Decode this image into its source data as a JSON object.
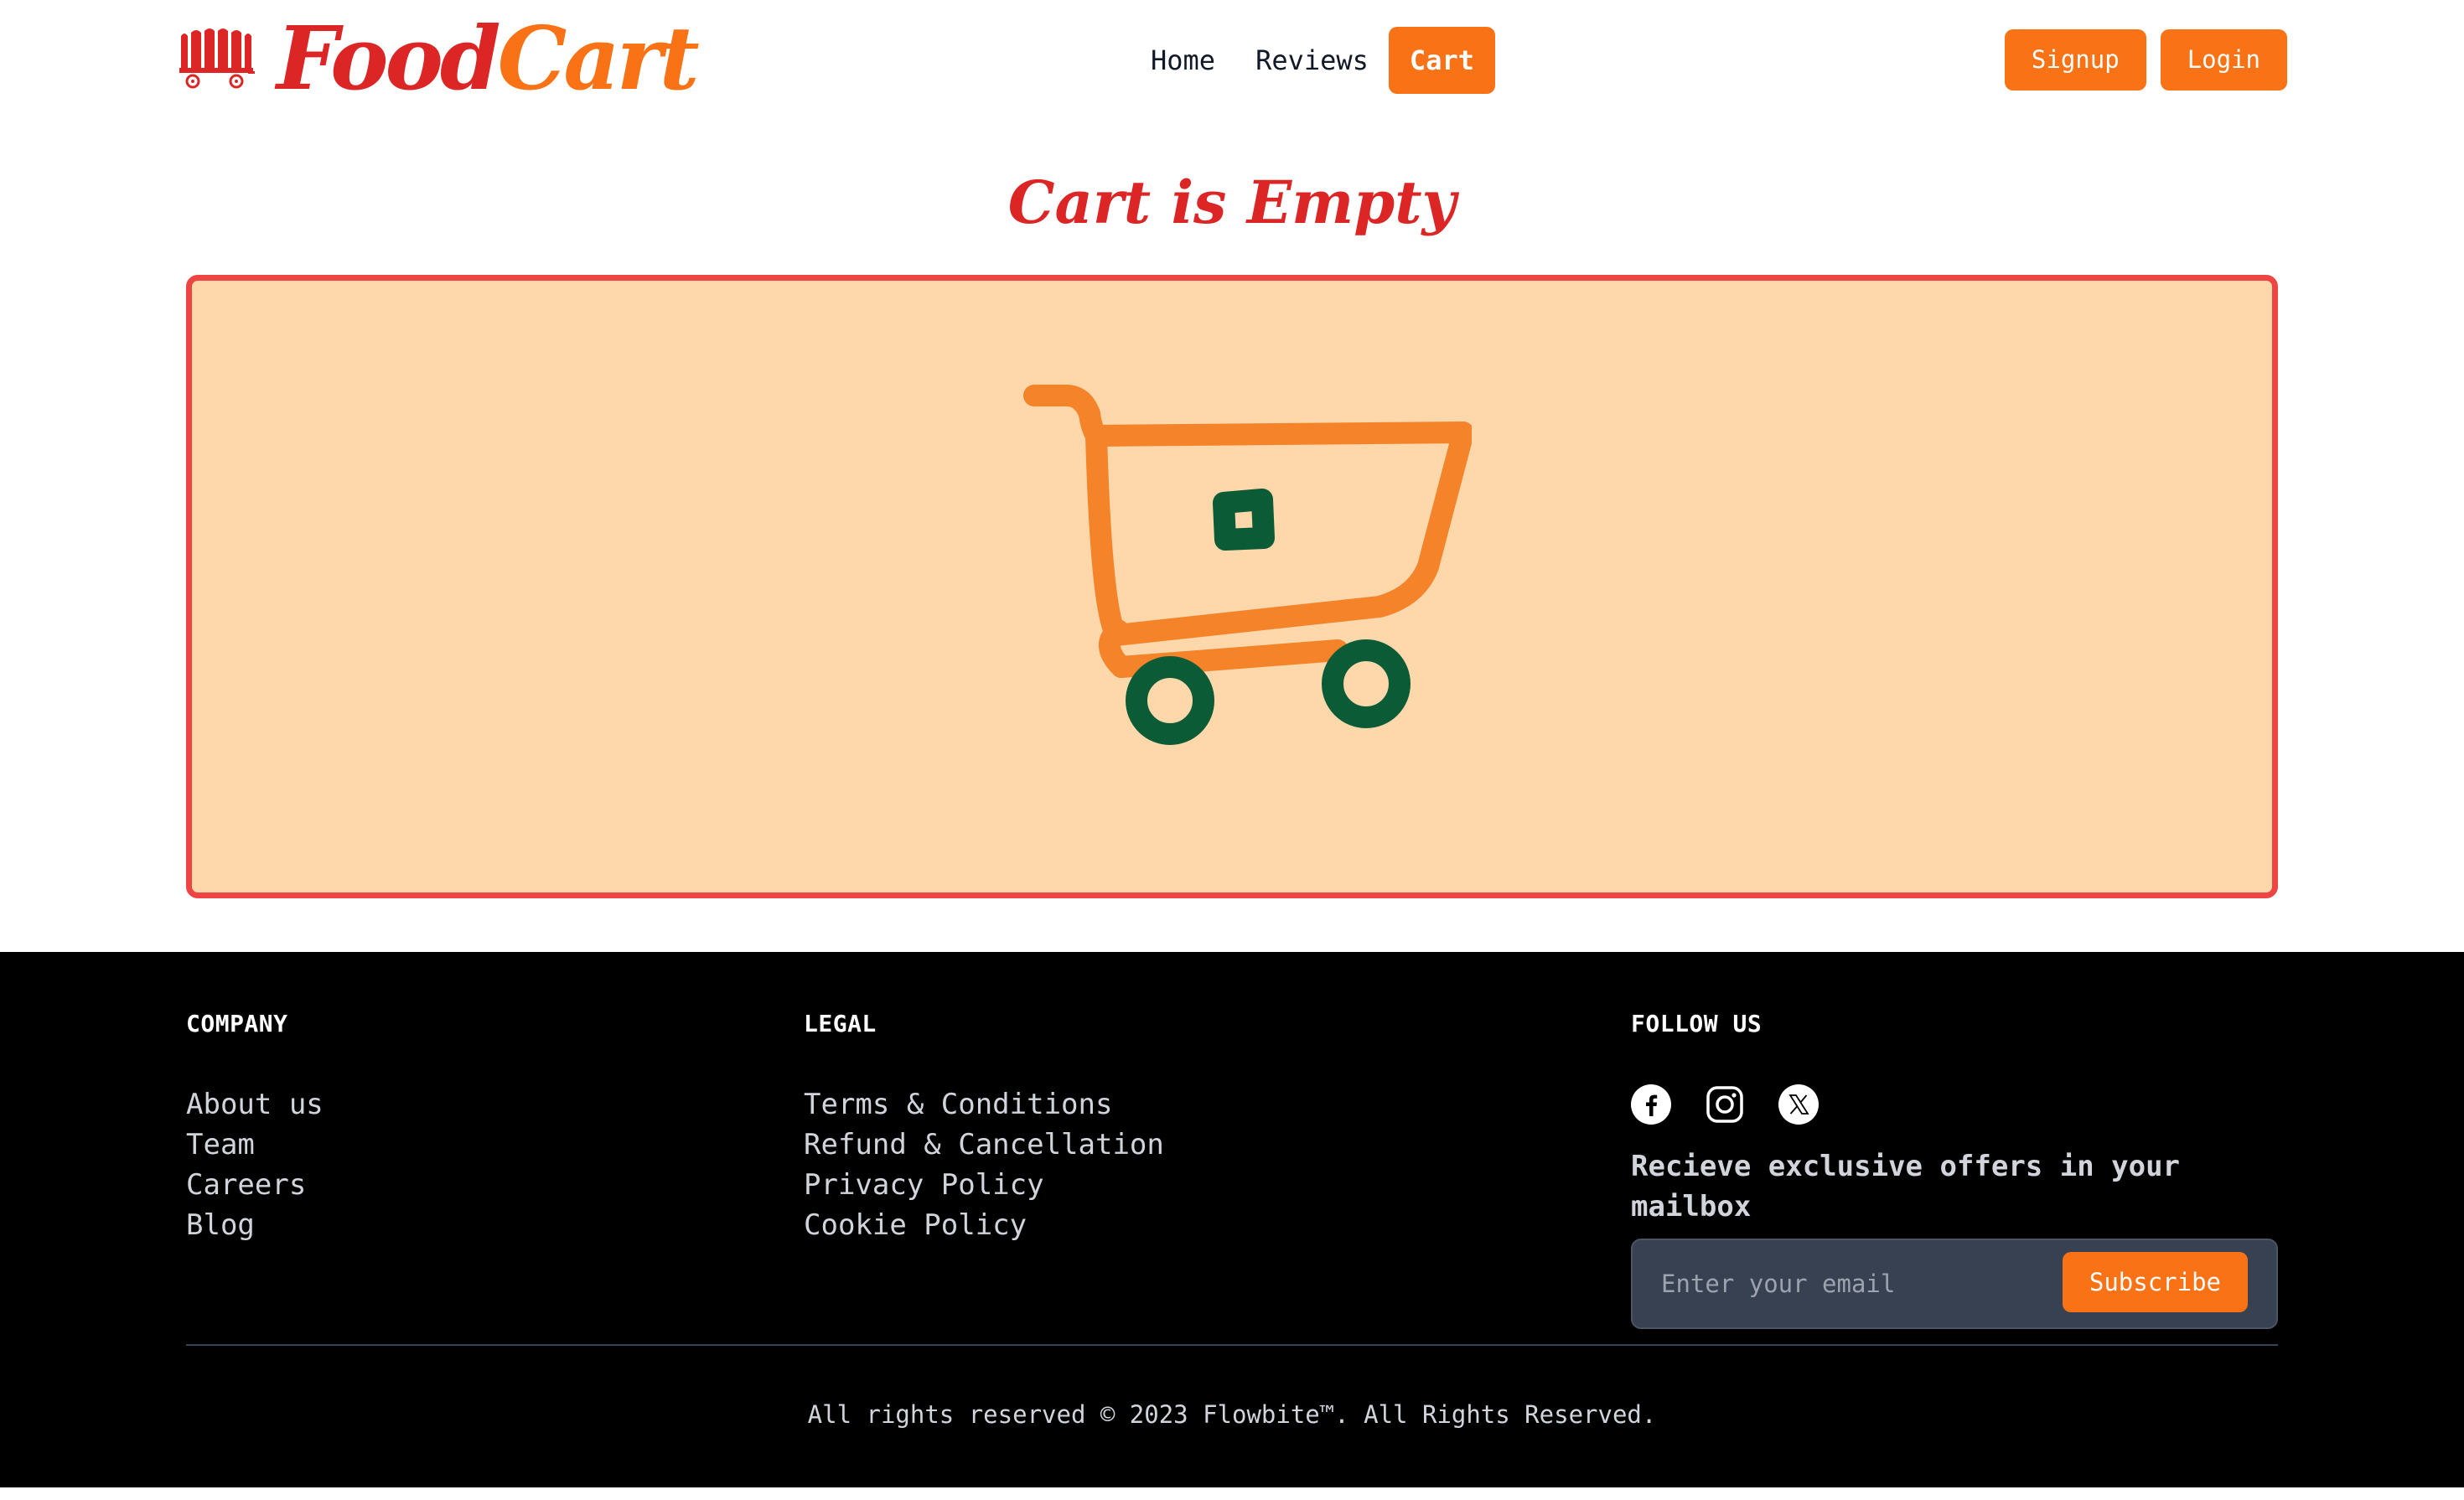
{
  "brand": {
    "name_part1": "Food",
    "name_part2": "Cart",
    "logo_icon": "covered-wagon-icon",
    "colors": {
      "primary": "#dc2626",
      "accent": "#f97316"
    }
  },
  "nav": {
    "items": [
      {
        "label": "Home",
        "active": false
      },
      {
        "label": "Reviews",
        "active": false
      },
      {
        "label": "Cart",
        "active": true
      }
    ]
  },
  "auth": {
    "signup_label": "Signup",
    "login_label": "Login"
  },
  "main": {
    "title": "Cart is Empty",
    "illustration": "empty-shopping-cart-icon",
    "panel_colors": {
      "background": "#fed7aa",
      "border": "#ef4444"
    }
  },
  "footer": {
    "company": {
      "heading": "COMPANY",
      "links": [
        "About us",
        "Team",
        "Careers",
        "Blog"
      ]
    },
    "legal": {
      "heading": "LEGAL",
      "links": [
        "Terms & Conditions",
        "Refund & Cancellation",
        "Privacy Policy",
        "Cookie Policy"
      ]
    },
    "follow": {
      "heading": "FOLLOW US",
      "social": [
        "facebook-icon",
        "instagram-icon",
        "x-twitter-icon"
      ],
      "offer_text": "Recieve exclusive offers in your mailbox",
      "email_placeholder": "Enter your email",
      "subscribe_label": "Subscribe"
    },
    "copyright": "All rights reserved © 2023 Flowbite™. All Rights Reserved."
  }
}
